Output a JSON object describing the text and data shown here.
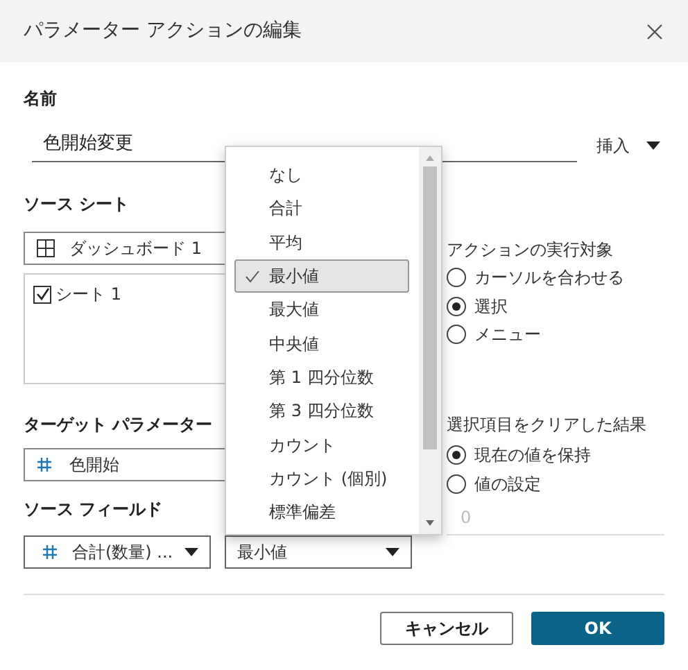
{
  "dialog": {
    "title": "パラメーター アクションの編集"
  },
  "name_section": {
    "label": "名前",
    "value": "色開始変更",
    "insert_button": "挿入"
  },
  "source_sheet": {
    "label": "ソース シート",
    "dashboard": "ダッシュボード 1",
    "sheets": [
      {
        "label": "シート 1",
        "checked": true
      }
    ]
  },
  "run_action_on": {
    "label": "アクションの実行対象",
    "options": [
      {
        "label": "カーソルを合わせる",
        "selected": false
      },
      {
        "label": "選択",
        "selected": true
      },
      {
        "label": "メニュー",
        "selected": false
      }
    ]
  },
  "target_parameter": {
    "label": "ターゲット パラメーター",
    "value": "色開始"
  },
  "clearing_selection": {
    "label": "選択項目をクリアした結果",
    "options": [
      {
        "label": "現在の値を保持",
        "selected": true
      },
      {
        "label": "値の設定",
        "selected": false
      }
    ],
    "value_field": "0"
  },
  "source_field": {
    "label": "ソース フィールド",
    "field": "合計(数量) ...",
    "aggregation": "最小値"
  },
  "aggregation_menu": {
    "items": [
      {
        "label": "なし",
        "selected": false
      },
      {
        "label": "合計",
        "selected": false
      },
      {
        "label": "平均",
        "selected": false
      },
      {
        "label": "最小値",
        "selected": true
      },
      {
        "label": "最大値",
        "selected": false
      },
      {
        "label": "中央値",
        "selected": false
      },
      {
        "label": "第 1 四分位数",
        "selected": false
      },
      {
        "label": "第 3 四分位数",
        "selected": false
      },
      {
        "label": "カウント",
        "selected": false
      },
      {
        "label": "カウント (個別)",
        "selected": false
      },
      {
        "label": "標準偏差",
        "selected": false
      }
    ]
  },
  "buttons": [
    {
      "label": "キャンセル",
      "kind": "secondary"
    },
    {
      "label": "OK",
      "kind": "primary"
    }
  ]
}
